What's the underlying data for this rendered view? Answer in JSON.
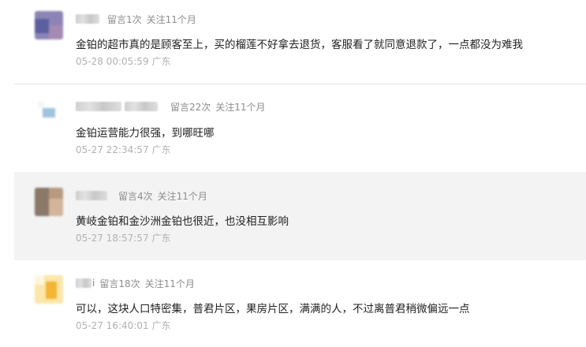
{
  "comments": [
    {
      "nickname_suffix": "",
      "messages": "留言1次",
      "follow": "关注11个月",
      "text": "金铂的超市真的是顾客至上，买的榴莲不好拿去退货，客服看了就同意退款了，一点都没为难我",
      "date": "05-28 00:05:59",
      "location": "广东",
      "avatar_colors": [
        "#8c84b5",
        "#5a5f9e",
        "#a58ab4"
      ]
    },
    {
      "nickname_suffix": "",
      "messages": "留言22次",
      "follow": "关注11个月",
      "text": "金铂运营能力很强，到哪旺哪",
      "date": "05-27 22:34:57",
      "location": "广东",
      "avatar_colors": [
        "#ffffff",
        "#9fc4e0",
        "#f2f6fa"
      ]
    },
    {
      "nickname_suffix": "",
      "messages": "留言4次",
      "follow": "关注11个月",
      "text": "黄岐金铂和金沙洲金铂也很近，也没相互影响",
      "date": "05-27 18:57:57",
      "location": "广东",
      "avatar_colors": [
        "#b79a7f",
        "#8a7868",
        "#d2b59a"
      ]
    },
    {
      "nickname_suffix": "i",
      "messages": "留言18次",
      "follow": "关注11个月",
      "text": "可以，这块人口特密集，普君片区，果房片区，满满的人，不过离普君稍微偏远一点",
      "date": "05-27 16:40:01",
      "location": "广东",
      "avatar_colors": [
        "#fbe7a8",
        "#f2b534",
        "#fff6dc"
      ]
    }
  ]
}
